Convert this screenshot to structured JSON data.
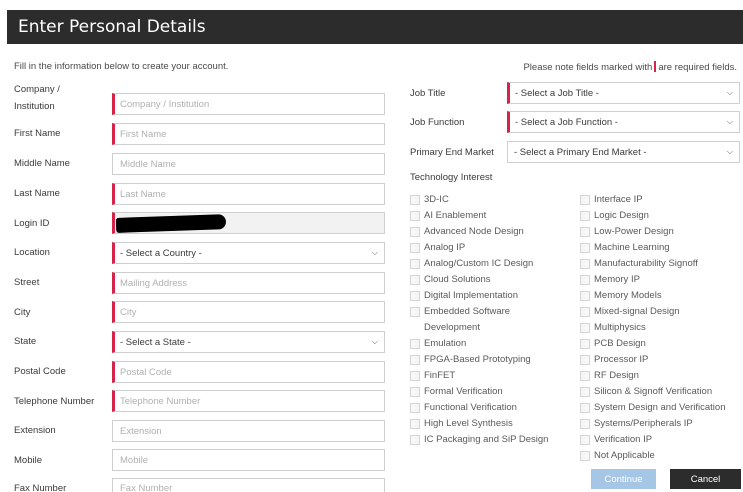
{
  "header": {
    "title": "Enter Personal Details"
  },
  "intro": "Fill in the information below to create your account.",
  "note": {
    "before": "Please note fields marked with",
    "after": "are required fields."
  },
  "left_fields": [
    {
      "label_line1": "Company /",
      "label_line2": "Institution",
      "placeholder": "Company / Institution"
    },
    {
      "label": "First Name",
      "placeholder": "First Name"
    },
    {
      "label": "Middle Name",
      "placeholder": "Middle Name"
    },
    {
      "label": "Last Name",
      "placeholder": "Last Name"
    },
    {
      "label": "Login ID",
      "value": ""
    },
    {
      "label": "Location",
      "selected": "- Select a Country -"
    },
    {
      "label": "Street",
      "placeholder": "Mailing Address"
    },
    {
      "label": "City",
      "placeholder": "City"
    },
    {
      "label": "State",
      "selected": "- Select a State -"
    },
    {
      "label": "Postal Code",
      "placeholder": "Postal Code"
    },
    {
      "label": "Telephone Number",
      "placeholder": "Telephone Number"
    },
    {
      "label": "Extension",
      "placeholder": "Extension"
    },
    {
      "label": "Mobile",
      "placeholder": "Mobile"
    },
    {
      "label": "Fax Number",
      "placeholder": "Fax Number"
    }
  ],
  "right_selects": [
    {
      "label": "Job Title",
      "selected": "- Select a Job Title -"
    },
    {
      "label": "Job Function",
      "selected": "- Select a Job Function -"
    },
    {
      "label": "Primary End Market",
      "selected": "- Select a Primary End Market -"
    }
  ],
  "tech_interest": {
    "heading": "Technology Interest",
    "col1": [
      "3D-IC",
      "AI Enablement",
      "Advanced Node Design",
      "Analog IP",
      "Analog/Custom IC Design",
      "Cloud Solutions",
      "Digital Implementation",
      "Embedded Software",
      "Development",
      "Emulation",
      "FPGA-Based Prototyping",
      "FinFET",
      "Formal Verification",
      "Functional Verification",
      "High Level Synthesis",
      "IC Packaging and SiP Design"
    ],
    "col2": [
      "Interface IP",
      "Logic Design",
      "Low-Power Design",
      "Machine Learning",
      "Manufacturability Signoff",
      "Memory IP",
      "Memory Models",
      "Mixed-signal Design",
      "Multiphysics",
      "PCB Design",
      "Processor IP",
      "RF Design",
      "Silicon & Signoff Verification",
      "System Design and Verification",
      "Systems/Peripherals IP",
      "Verification IP",
      "Not Applicable"
    ]
  },
  "buttons": {
    "continue": "Continue",
    "cancel": "Cancel"
  },
  "colors": {
    "header_bg": "#2c2c2c",
    "required_marker": "#d6234a",
    "continue_bg": "#a6c6e6",
    "cancel_bg": "#2c2c2c"
  },
  "icons": {
    "select": "chevron-down-icon"
  }
}
